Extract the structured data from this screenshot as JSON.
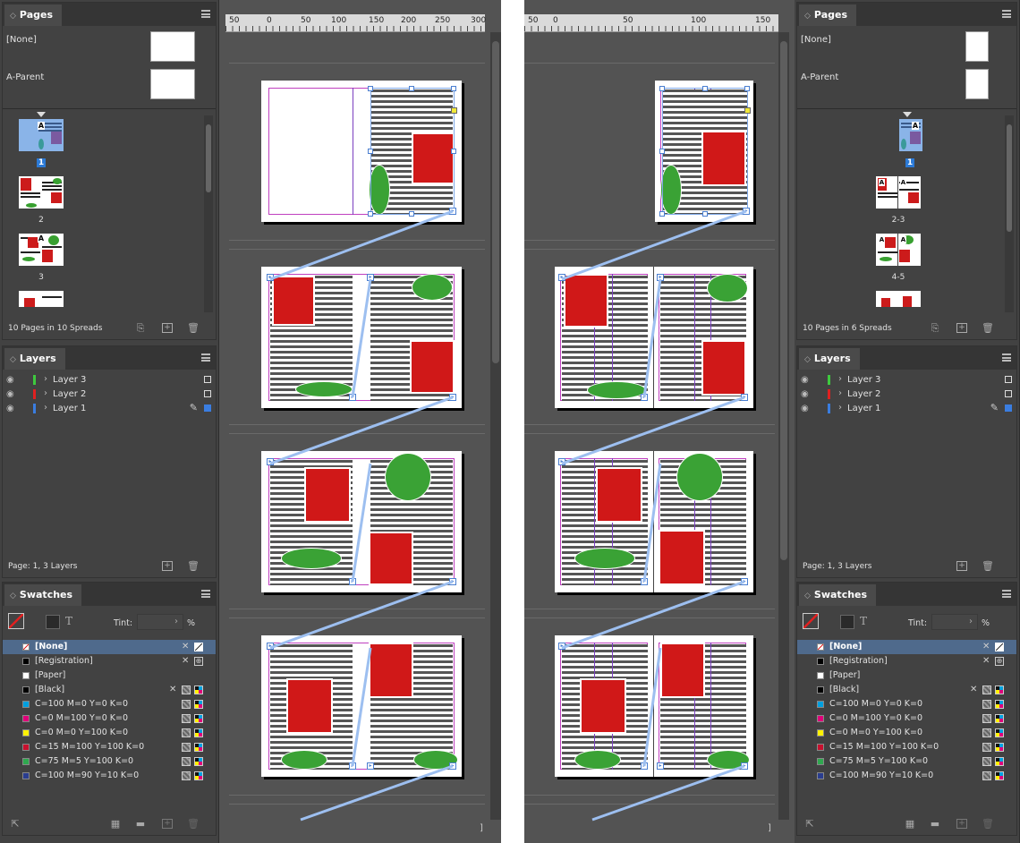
{
  "left": {
    "pages_panel": {
      "title": "Pages",
      "parents": [
        "[None]",
        "A-Parent"
      ],
      "thumbs": [
        {
          "label": "1",
          "selected": true
        },
        {
          "label": "2",
          "selected": false
        },
        {
          "label": "3",
          "selected": false
        }
      ],
      "footer": "10 Pages in 10 Spreads"
    },
    "layers_panel": {
      "title": "Layers",
      "layers": [
        {
          "name": "Layer 3",
          "color": "#3ec93e"
        },
        {
          "name": "Layer 2",
          "color": "#e02020"
        },
        {
          "name": "Layer 1",
          "color": "#3a7de0"
        }
      ],
      "footer": "Page: 1, 3 Layers"
    },
    "swatches_panel": {
      "title": "Swatches",
      "tint_label": "Tint:",
      "tint_unit": "%",
      "swatches": [
        {
          "name": "[None]",
          "color": "none"
        },
        {
          "name": "[Registration]",
          "color": "#000000"
        },
        {
          "name": "[Paper]",
          "color": "#ffffff"
        },
        {
          "name": "[Black]",
          "color": "#000000"
        },
        {
          "name": "C=100 M=0 Y=0 K=0",
          "color": "#00a0e0"
        },
        {
          "name": "C=0 M=100 Y=0 K=0",
          "color": "#e0007a"
        },
        {
          "name": "C=0 M=0 Y=100 K=0",
          "color": "#fff200"
        },
        {
          "name": "C=15 M=100 Y=100 K=0",
          "color": "#c8102e"
        },
        {
          "name": "C=75 M=5 Y=100 K=0",
          "color": "#2fa84f"
        },
        {
          "name": "C=100 M=90 Y=10 K=0",
          "color": "#2a3d8f"
        }
      ]
    },
    "ruler_labels": [
      "50",
      "0",
      "50",
      "100",
      "150",
      "200",
      "250",
      "300"
    ]
  },
  "right": {
    "pages_panel": {
      "title": "Pages",
      "parents": [
        "[None]",
        "A-Parent"
      ],
      "thumbs": [
        {
          "label": "1",
          "selected": true
        },
        {
          "label": "2-3",
          "selected": false
        },
        {
          "label": "4-5",
          "selected": false
        }
      ],
      "footer": "10 Pages in 6 Spreads"
    },
    "layers_panel": {
      "title": "Layers",
      "layers": [
        {
          "name": "Layer 3",
          "color": "#3ec93e"
        },
        {
          "name": "Layer 2",
          "color": "#e02020"
        },
        {
          "name": "Layer 1",
          "color": "#3a7de0"
        }
      ],
      "footer": "Page: 1, 3 Layers"
    },
    "swatches_panel": {
      "title": "Swatches",
      "tint_label": "Tint:",
      "tint_unit": "%",
      "swatches": [
        {
          "name": "[None]",
          "color": "none"
        },
        {
          "name": "[Registration]",
          "color": "#000000"
        },
        {
          "name": "[Paper]",
          "color": "#ffffff"
        },
        {
          "name": "[Black]",
          "color": "#000000"
        },
        {
          "name": "C=100 M=0 Y=0 K=0",
          "color": "#00a0e0"
        },
        {
          "name": "C=0 M=100 Y=0 K=0",
          "color": "#e0007a"
        },
        {
          "name": "C=0 M=0 Y=100 K=0",
          "color": "#fff200"
        },
        {
          "name": "C=15 M=100 Y=100 K=0",
          "color": "#c8102e"
        },
        {
          "name": "C=75 M=5 Y=100 K=0",
          "color": "#2fa84f"
        },
        {
          "name": "C=100 M=90 Y=10 K=0",
          "color": "#2a3d8f"
        }
      ]
    },
    "ruler_labels": [
      "50",
      "0",
      "50",
      "100",
      "150"
    ]
  }
}
